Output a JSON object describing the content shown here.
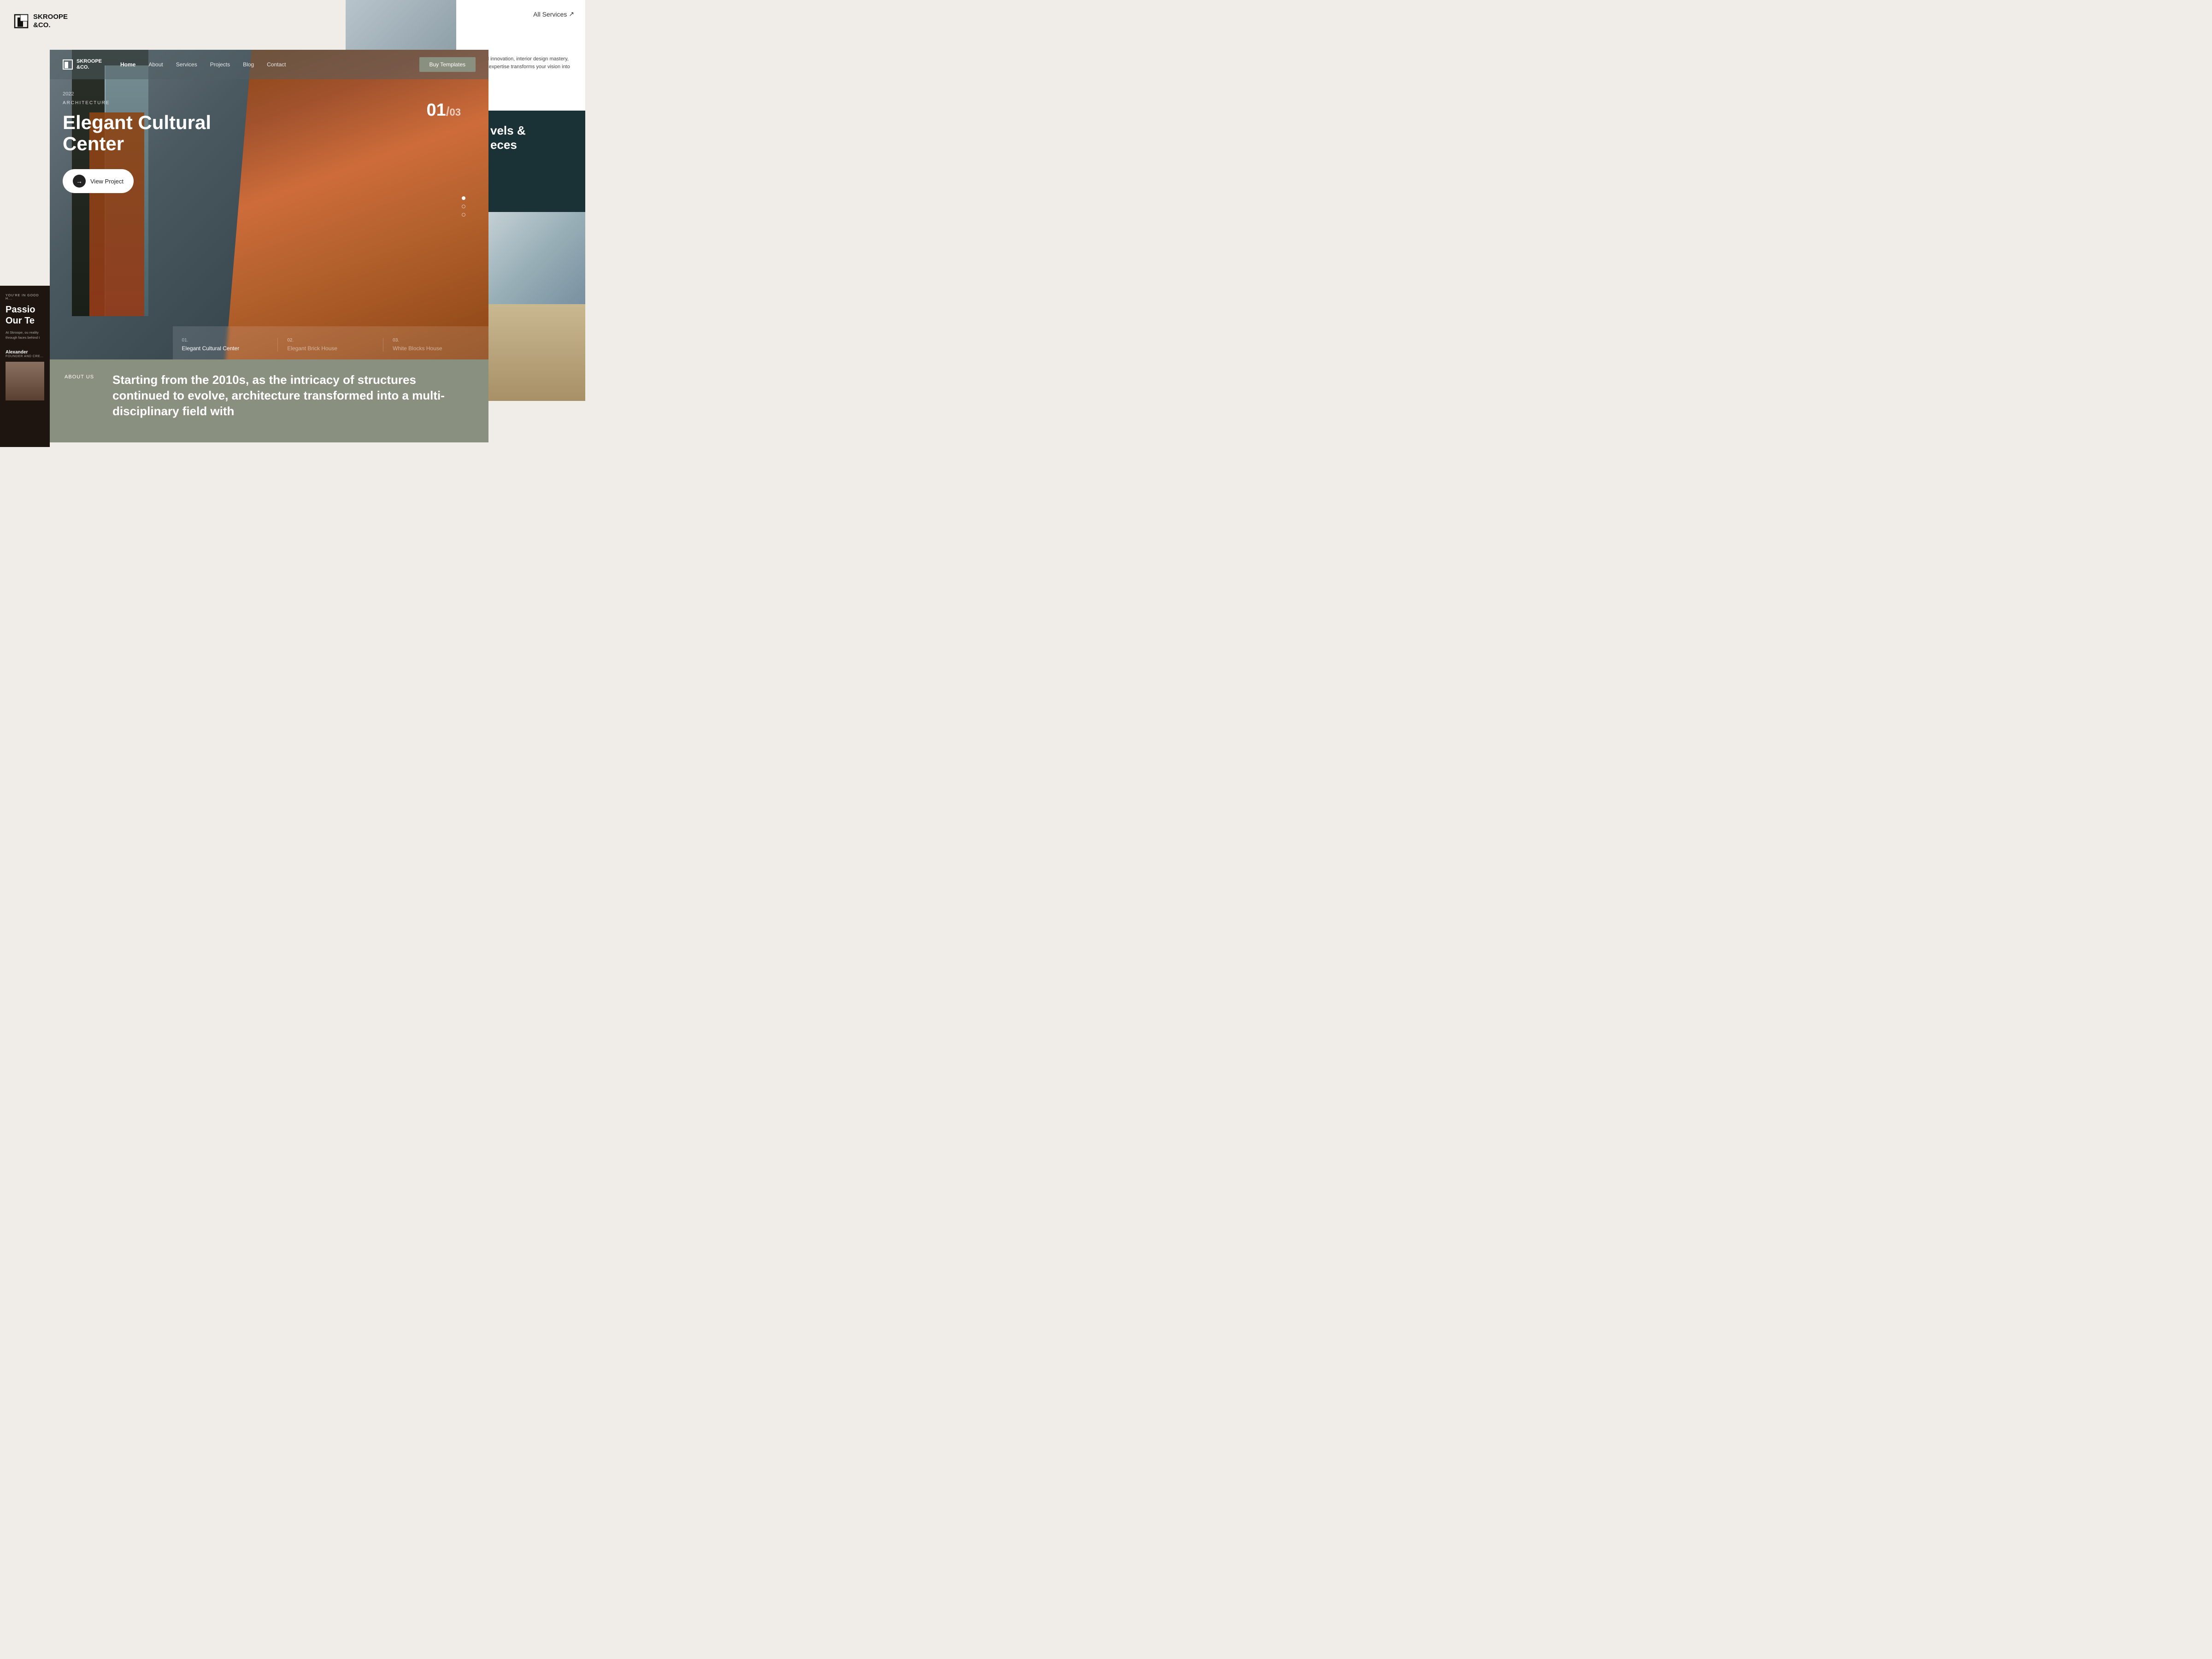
{
  "brand": {
    "name": "SKROOPE\n&CO.",
    "name_nav": "SKROOPE\n&CO."
  },
  "top_right": {
    "all_services_label": "All Services",
    "arrow": "↗",
    "description": "Explore Skroope's suite of services, delivering architectural innovation, interior design mastery, sustainable solutions, and personalized consultations. Our expertise transforms your vision into sophisticated, and Skroope"
  },
  "right_dark": {
    "text_line1": "vels &",
    "text_line2": "eces"
  },
  "nav": {
    "links": [
      {
        "label": "Home",
        "active": true
      },
      {
        "label": "About",
        "active": false
      },
      {
        "label": "Services",
        "active": false
      },
      {
        "label": "Projects",
        "active": false
      },
      {
        "label": "Blog",
        "active": false
      },
      {
        "label": "Contact",
        "active": false
      }
    ],
    "cta_label": "Buy Templates"
  },
  "hero": {
    "year": "2022",
    "category": "ARCHITECTURE",
    "title": "Elegant Cultural Center",
    "cta_label": "View Project",
    "slide_current": "01",
    "slide_separator": "/",
    "slide_total": "03"
  },
  "projects": [
    {
      "num": "01.",
      "name": "Elegant Cultural Center",
      "muted": false
    },
    {
      "num": "02.",
      "name": "Elegant Brick House",
      "muted": true
    },
    {
      "num": "03.",
      "name": "White Blocks House",
      "muted": true
    }
  ],
  "about": {
    "label": "ABOUT US",
    "text": "Starting from the 2010s, as the intricacy of structures continued to evolve, architecture transformed into a multi-disciplinary field with"
  },
  "left_side": {
    "badge": "YOU'RE IN GOOD H...",
    "passion_line1": "Passio",
    "passion_line2": "Our Te",
    "description": "At Skroope, ou reality through faces behind t",
    "person_name": "Alexander",
    "person_title": "FOUNDER AND CRE..."
  }
}
